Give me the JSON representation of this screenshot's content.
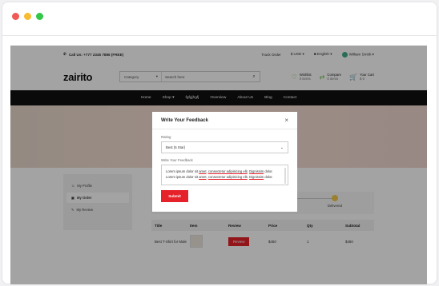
{
  "topbar": {
    "phone": "Call Us: +777 2345 7886 (FREE)",
    "track_order": "Track Order",
    "currency": "$ USD",
    "language": "English",
    "user": "William Smith"
  },
  "header": {
    "logo": "zairito",
    "category_label": "Category",
    "search_placeholder": "Search here",
    "wishlist_label": "Wishlist",
    "wishlist_count": "0 items",
    "compare_label": "Compare",
    "compare_count": "0 items",
    "cart_label": "Your Cart",
    "cart_total": "$ 0"
  },
  "nav": [
    "Home",
    "Shop",
    "fgfgjhgfj",
    "Overview",
    "About Us",
    "Blog",
    "Contact"
  ],
  "sidebar": [
    {
      "label": "My Profile"
    },
    {
      "label": "My Order"
    },
    {
      "label": "My Review"
    }
  ],
  "progress": [
    "Processing",
    "Shipped",
    "Delivered"
  ],
  "orders": {
    "headers": [
      "Title",
      "Item",
      "Review",
      "Price",
      "Qty",
      "Subtotal"
    ],
    "rows": [
      {
        "title": "Best T-Shirt for Male",
        "review": "Review",
        "price": "$450",
        "qty": "1",
        "subtotal": "$450"
      }
    ]
  },
  "modal": {
    "title": "Write Your Feedback",
    "close": "×",
    "rating_label": "Rating",
    "rating_value": "Best (5 Star)",
    "feedback_label": "Write Your Feedback",
    "feedback_line1_a": "Lorem ipsum dolor sit ",
    "feedback_line1_b": "amet",
    "feedback_line1_c": ", ",
    "feedback_line1_d": "consectetur adipisicing elit",
    "feedback_line1_e": ". ",
    "feedback_line1_f": "Dignissim",
    "feedback_line1_g": " dolor.",
    "feedback_line2_a": "Lorem ipsum dolor sit ",
    "feedback_line2_b": "amet",
    "feedback_line2_c": ", ",
    "feedback_line2_d": "consectetur adipisicing elit",
    "feedback_line2_e": ". ",
    "feedback_line2_f": "Dignissim",
    "feedback_line2_g": " dolor.",
    "submit_label": "Submit"
  },
  "colors": {
    "accent": "#e52129",
    "nav_bg": "#111111"
  }
}
